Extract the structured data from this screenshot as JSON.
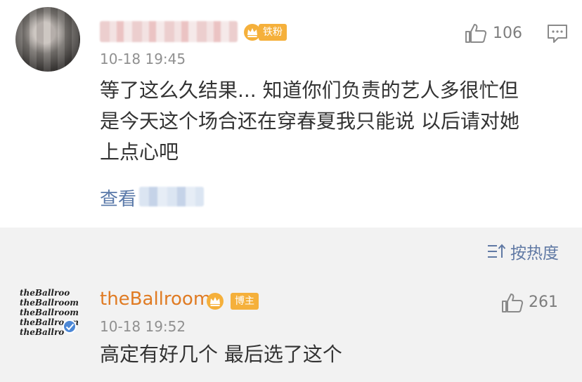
{
  "comment": {
    "time": "10-18 19:45",
    "badge": "铁粉",
    "like_count": "106",
    "lines": [
      "等了这么久结果... 知道你们负责的艺人多很忙但",
      "是今天这个场合还在穿春夏我只能说 以后请对她",
      "上点心吧"
    ],
    "view_more": "查看"
  },
  "sort": {
    "label": "按热度"
  },
  "reply": {
    "avatar_lines": [
      "theBallroo",
      "theBallroom",
      "theBallroom",
      "theBallroom",
      "theBallro"
    ],
    "name": "theBallroom",
    "badge": "博主",
    "time": "10-18 19:52",
    "like_count": "261",
    "text": "高定有好几个 最后选了这个"
  },
  "colors": {
    "accent_blue": "#5a79a9",
    "name_orange": "#e07b23",
    "badge_orange": "#f5b03b"
  }
}
